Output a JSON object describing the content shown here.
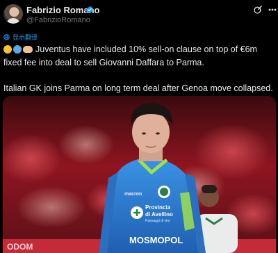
{
  "author": {
    "name": "Fabrizio Romano",
    "handle": "@FabrizioRomano"
  },
  "translate_label": "显示翻译",
  "tweet": {
    "line1": "Juventus have included 10% sell-on clause on top of €6m fixed fee into deal to sell Giovanni Daffara to Parma.",
    "line2": "Italian GK joins Parma on long term deal after Genoa move collapsed."
  },
  "photo": {
    "shirt_brand": "macron",
    "sponsor_line1": "Provincia",
    "sponsor_line2": "di Avellino",
    "sponsor_line3": "Paesaggi di vini",
    "sponsor_bottom": "MOSMOPOL",
    "ad_board_text": "ODOM"
  },
  "colors": {
    "accent_blue": "#1d9bf0",
    "jersey_blue": "#2b7fd4",
    "jersey_trim": "#9ee04d",
    "stadium_red": "#8e1520"
  }
}
